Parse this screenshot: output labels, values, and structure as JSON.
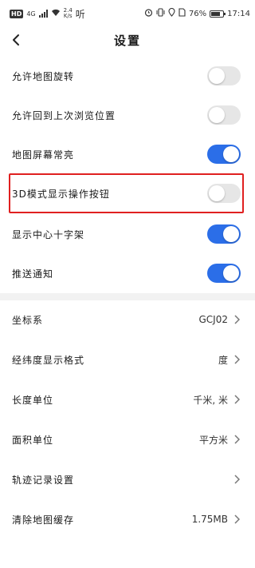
{
  "status_bar": {
    "hd": "HD",
    "network": "4G",
    "speed_value": "2.4",
    "speed_unit": "K/s",
    "app_text": "听",
    "battery": "76%",
    "battery_level": 0.76,
    "time": "17:14"
  },
  "header": {
    "title": "设置"
  },
  "toggles": [
    {
      "label": "允许地图旋转",
      "on": false
    },
    {
      "label": "允许回到上次浏览位置",
      "on": false
    },
    {
      "label": "地图屏幕常亮",
      "on": true
    },
    {
      "label": "3D模式显示操作按钮",
      "on": false
    },
    {
      "label": "显示中心十字架",
      "on": true
    },
    {
      "label": "推送通知",
      "on": true
    }
  ],
  "options": [
    {
      "label": "坐标系",
      "value": "GCJ02"
    },
    {
      "label": "经纬度显示格式",
      "value": "度"
    },
    {
      "label": "长度单位",
      "value": "千米, 米"
    },
    {
      "label": "面积单位",
      "value": "平方米"
    },
    {
      "label": "轨迹记录设置",
      "value": ""
    },
    {
      "label": "清除地图缓存",
      "value": "1.75MB"
    }
  ],
  "colors": {
    "toggle_on": "#2b6ee8",
    "toggle_off": "#e6e6e6",
    "highlight": "#e02020"
  }
}
